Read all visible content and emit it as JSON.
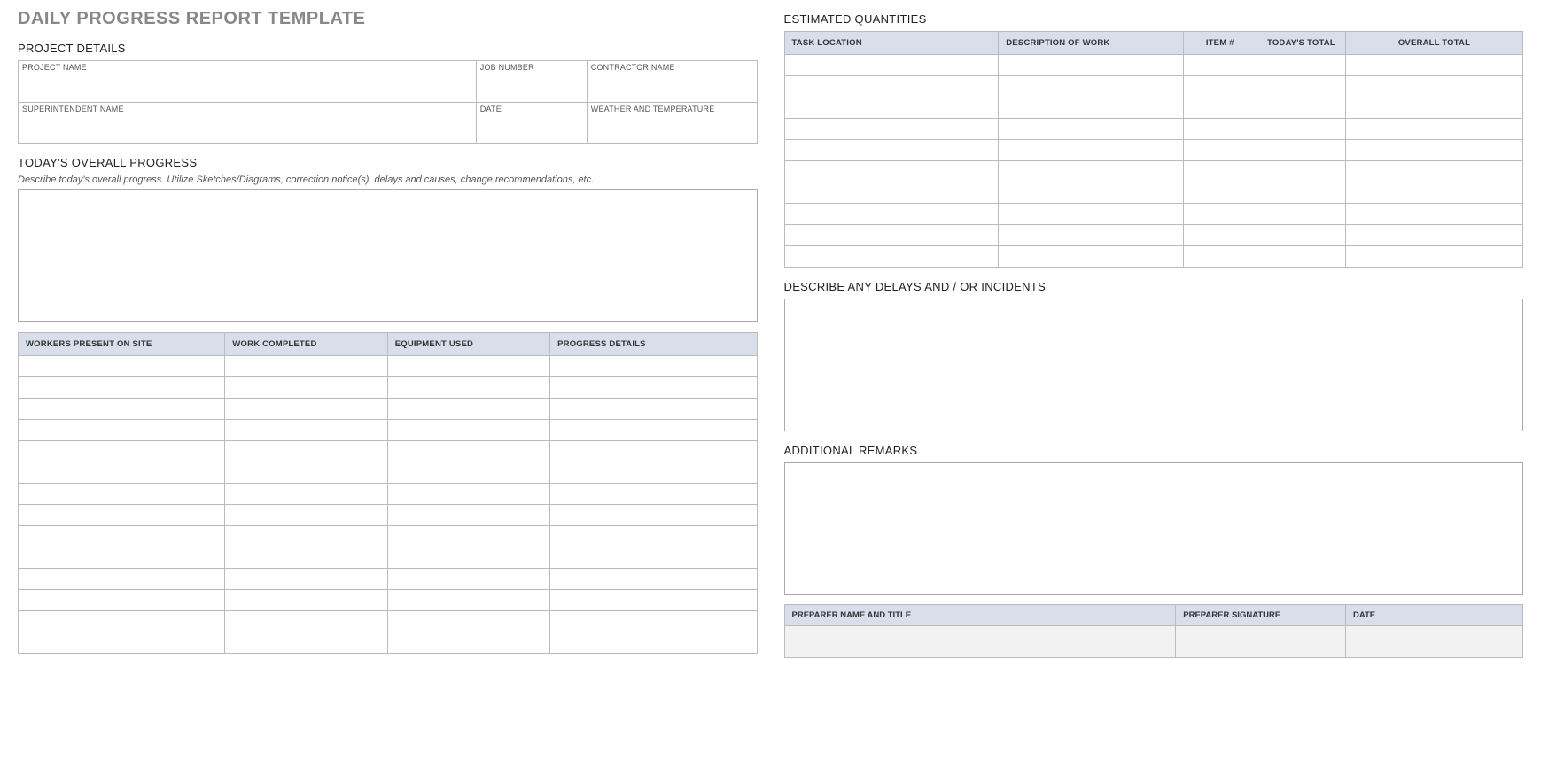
{
  "title": "DAILY PROGRESS REPORT TEMPLATE",
  "projectDetails": {
    "heading": "PROJECT DETAILS",
    "labels": {
      "projectName": "PROJECT NAME",
      "jobNumber": "JOB NUMBER",
      "contractorName": "CONTRACTOR NAME",
      "superintendentName": "SUPERINTENDENT NAME",
      "date": "DATE",
      "weather": "WEATHER AND TEMPERATURE"
    },
    "values": {
      "projectName": "",
      "jobNumber": "",
      "contractorName": "",
      "superintendentName": "",
      "date": "",
      "weather": ""
    }
  },
  "overallProgress": {
    "heading": "TODAY'S OVERALL PROGRESS",
    "hint": "Describe today's overall progress.  Utilize Sketches/Diagrams, correction notice(s), delays and causes, change recommendations, etc.",
    "value": ""
  },
  "progressTable": {
    "headers": [
      "WORKERS PRESENT ON SITE",
      "WORK COMPLETED",
      "EQUIPMENT USED",
      "PROGRESS DETAILS"
    ],
    "rows": [
      [
        "",
        "",
        "",
        ""
      ],
      [
        "",
        "",
        "",
        ""
      ],
      [
        "",
        "",
        "",
        ""
      ],
      [
        "",
        "",
        "",
        ""
      ],
      [
        "",
        "",
        "",
        ""
      ],
      [
        "",
        "",
        "",
        ""
      ],
      [
        "",
        "",
        "",
        ""
      ],
      [
        "",
        "",
        "",
        ""
      ],
      [
        "",
        "",
        "",
        ""
      ],
      [
        "",
        "",
        "",
        ""
      ],
      [
        "",
        "",
        "",
        ""
      ],
      [
        "",
        "",
        "",
        ""
      ],
      [
        "",
        "",
        "",
        ""
      ],
      [
        "",
        "",
        "",
        ""
      ]
    ]
  },
  "estimated": {
    "heading": "ESTIMATED QUANTITIES",
    "headers": [
      "TASK LOCATION",
      "DESCRIPTION OF WORK",
      "ITEM #",
      "TODAY'S TOTAL",
      "OVERALL TOTAL"
    ],
    "rows": [
      [
        "",
        "",
        "",
        "",
        ""
      ],
      [
        "",
        "",
        "",
        "",
        ""
      ],
      [
        "",
        "",
        "",
        "",
        ""
      ],
      [
        "",
        "",
        "",
        "",
        ""
      ],
      [
        "",
        "",
        "",
        "",
        ""
      ],
      [
        "",
        "",
        "",
        "",
        ""
      ],
      [
        "",
        "",
        "",
        "",
        ""
      ],
      [
        "",
        "",
        "",
        "",
        ""
      ],
      [
        "",
        "",
        "",
        "",
        ""
      ],
      [
        "",
        "",
        "",
        "",
        ""
      ]
    ]
  },
  "delays": {
    "heading": "DESCRIBE ANY DELAYS AND / OR INCIDENTS",
    "value": ""
  },
  "remarks": {
    "heading": "ADDITIONAL REMARKS",
    "value": ""
  },
  "signoff": {
    "headers": [
      "PREPARER NAME AND TITLE",
      "PREPARER SIGNATURE",
      "DATE"
    ],
    "values": [
      "",
      "",
      ""
    ]
  }
}
